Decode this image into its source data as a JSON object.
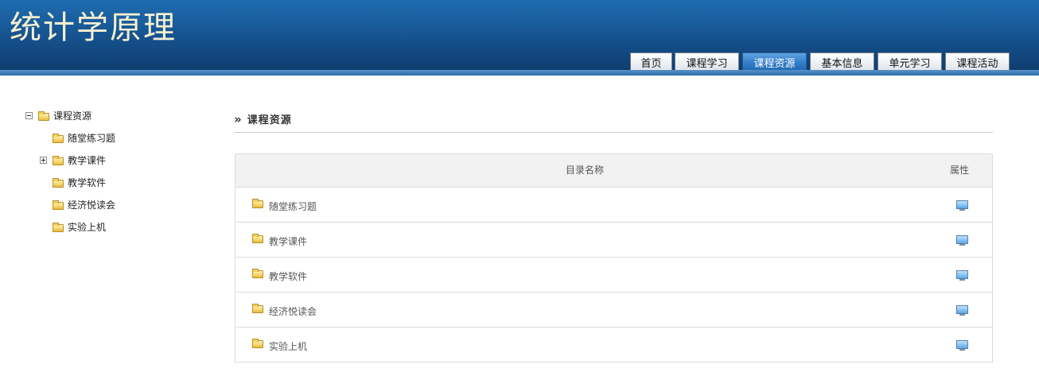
{
  "header": {
    "site_title": "统计学原理",
    "nav": [
      {
        "label": "首页",
        "active": false
      },
      {
        "label": "课程学习",
        "active": false
      },
      {
        "label": "课程资源",
        "active": true
      },
      {
        "label": "基本信息",
        "active": false
      },
      {
        "label": "单元学习",
        "active": false
      },
      {
        "label": "课程活动",
        "active": false
      }
    ]
  },
  "tree": {
    "root": {
      "label": "课程资源",
      "expanded": true
    },
    "children": [
      {
        "label": "随堂练习题",
        "has_children": false
      },
      {
        "label": "教学课件",
        "has_children": true
      },
      {
        "label": "教学软件",
        "has_children": false
      },
      {
        "label": "经济悦读会",
        "has_children": false
      },
      {
        "label": "实验上机",
        "has_children": false
      }
    ]
  },
  "main": {
    "section_title": "课程资源",
    "table": {
      "col_name": "目录名称",
      "col_prop": "属性",
      "rows": [
        {
          "name": "随堂练习题",
          "prop_icon": "monitor-icon"
        },
        {
          "name": "教学课件",
          "prop_icon": "monitor-icon"
        },
        {
          "name": "教学软件",
          "prop_icon": "monitor-icon"
        },
        {
          "name": "经济悦读会",
          "prop_icon": "monitor-icon"
        },
        {
          "name": "实验上机",
          "prop_icon": "monitor-icon"
        }
      ]
    }
  },
  "colors": {
    "header_top": "#1f6db1",
    "header_bottom": "#0d3b6b",
    "title_text": "#f4f0d2",
    "active_tab": "#2c78c4"
  }
}
